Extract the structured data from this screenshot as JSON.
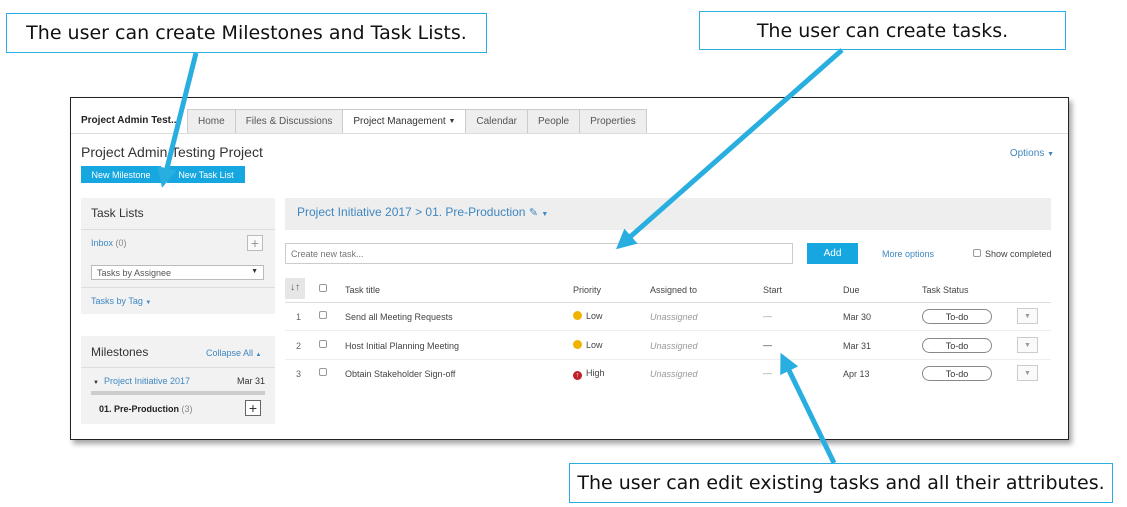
{
  "callouts": {
    "top_left": "The user can create Milestones and Task Lists.",
    "top_right": "The user can create tasks.",
    "bottom": "The user can edit existing tasks and all their attributes."
  },
  "app": {
    "project_name": "Project Admin Test...",
    "tabs": [
      "Home",
      "Files & Discussions",
      "Project Management",
      "Calendar",
      "People",
      "Properties"
    ],
    "active_tab": "Project Management",
    "page_title": "Project Admin Testing Project",
    "options_label": "Options",
    "new_milestone": "New Milestone",
    "new_task_list": "New Task List"
  },
  "sidebar": {
    "task_lists_title": "Task Lists",
    "inbox_label": "Inbox",
    "inbox_count": "(0)",
    "assignee_select": "Tasks by Assignee",
    "tasks_by_tag": "Tasks by Tag",
    "milestones_title": "Milestones",
    "collapse_all": "Collapse All",
    "milestone_name": "Project Initiative 2017",
    "milestone_date": "Mar 31",
    "list_name": "01. Pre-Production",
    "list_count": "(3)"
  },
  "main": {
    "breadcrumb": "Project Initiative 2017 > 01. Pre-Production",
    "new_task_placeholder": "Create new task...",
    "add_button": "Add",
    "more_options": "More options",
    "show_completed": "Show completed",
    "columns": {
      "title": "Task title",
      "priority": "Priority",
      "assigned": "Assigned to",
      "start": "Start",
      "due": "Due",
      "status": "Task Status"
    },
    "tasks": [
      {
        "num": "1",
        "title": "Send all Meeting Requests",
        "priority": "Low",
        "assigned": "Unassigned",
        "start": "—",
        "due": "Mar 30",
        "status": "To-do"
      },
      {
        "num": "2",
        "title": "Host Initial Planning Meeting",
        "priority": "Low",
        "assigned": "Unassigned",
        "start": "—",
        "due": "Mar 31",
        "status": "To-do"
      },
      {
        "num": "3",
        "title": "Obtain Stakeholder Sign-off",
        "priority": "High",
        "assigned": "Unassigned",
        "start": "—",
        "due": "Apr 13",
        "status": "To-do"
      }
    ]
  },
  "colors": {
    "accent": "#29aee0",
    "button": "#16a6e0",
    "link": "#3f87c1",
    "priority_low": "#f0b400",
    "priority_high": "#c0202a"
  }
}
